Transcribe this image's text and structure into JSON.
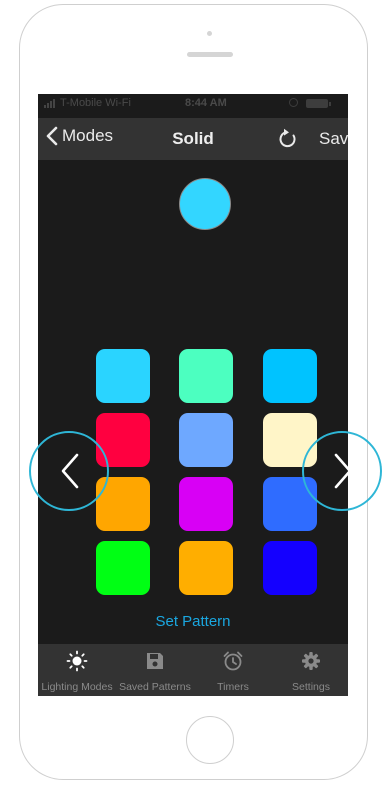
{
  "status_bar": {
    "carrier": "T-Mobile Wi-Fi",
    "time": "8:44 AM"
  },
  "nav": {
    "back_label": "Modes",
    "title": "Solid",
    "save_label": "Save",
    "back_icon": "chevron-left-icon",
    "refresh_icon": "refresh-icon"
  },
  "preview": {
    "color": "#33d6ff"
  },
  "palette": [
    [
      "#2ad4ff",
      "#4cffc0",
      "#00c3ff"
    ],
    [
      "#ff0040",
      "#6ea8ff",
      "#fff5c8"
    ],
    [
      "#ffa600",
      "#d800f5",
      "#2f6cff"
    ],
    [
      "#00ff14",
      "#ffae00",
      "#1400ff"
    ]
  ],
  "set_pattern_label": "Set Pattern",
  "tabs": [
    {
      "label": "Lighting Modes",
      "icon": "sun-icon",
      "active": true
    },
    {
      "label": "Saved Patterns",
      "icon": "floppy-disk-icon",
      "active": false
    },
    {
      "label": "Timers",
      "icon": "alarm-clock-icon",
      "active": false
    },
    {
      "label": "Settings",
      "icon": "gear-icon",
      "active": false
    }
  ],
  "arrow_color": "#2eb6d6",
  "accent_color": "#1aa7e0"
}
